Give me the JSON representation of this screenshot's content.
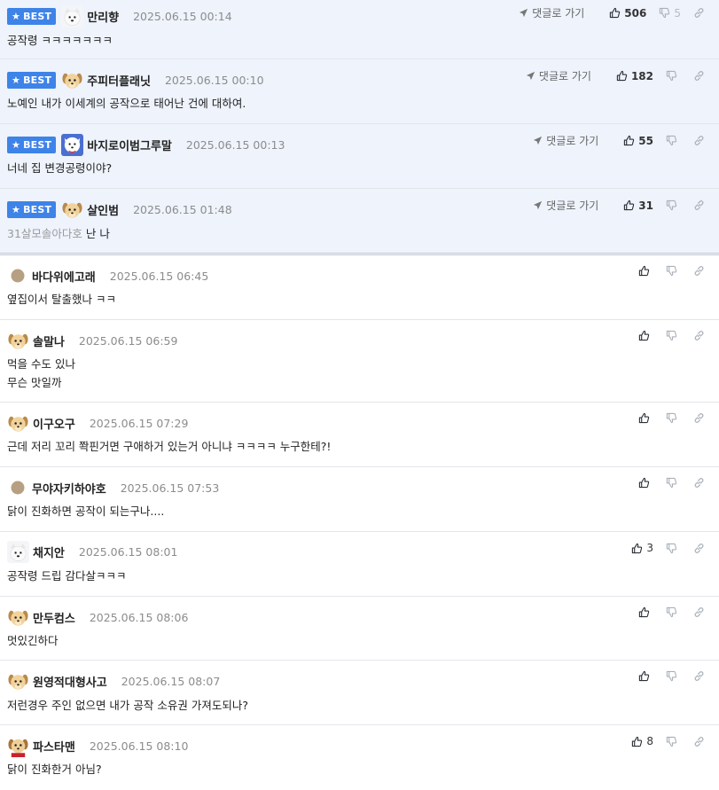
{
  "best_badge": "BEST",
  "goto_label": "댓글로 가기",
  "comments": [
    {
      "best": true,
      "avatar": "white-dog",
      "nick": "만리향",
      "date": "2025.06.15 00:14",
      "mention": "",
      "lines": [
        "공작령 ㅋㅋㅋㅋㅋㅋㅋ"
      ],
      "up": "506",
      "down": "5"
    },
    {
      "best": true,
      "avatar": "puppy",
      "nick": "주피터플래닛",
      "date": "2025.06.15 00:10",
      "mention": "",
      "lines": [
        "노예인 내가 이세계의 공작으로 태어난 건에 대하여."
      ],
      "up": "182",
      "down": ""
    },
    {
      "best": true,
      "avatar": "blue-pup",
      "nick": "바지로이범그루말",
      "date": "2025.06.15 00:13",
      "mention": "",
      "lines": [
        "너네 집 변경공령이야?"
      ],
      "up": "55",
      "down": ""
    },
    {
      "best": true,
      "avatar": "puppy",
      "nick": "살인범",
      "date": "2025.06.15 01:48",
      "mention": "31살모솔아다호",
      "lines": [
        "난 나"
      ],
      "up": "31",
      "down": ""
    },
    {
      "best": false,
      "avatar": "circle",
      "nick": "바다위에고래",
      "date": "2025.06.15 06:45",
      "mention": "",
      "lines": [
        "옆집이서 탈출했나 ㅋㅋ"
      ],
      "up": "",
      "down": ""
    },
    {
      "best": false,
      "avatar": "puppy",
      "nick": "솔말나",
      "date": "2025.06.15 06:59",
      "mention": "",
      "lines": [
        "먹을 수도 있나",
        "무슨 맛일까"
      ],
      "up": "",
      "down": ""
    },
    {
      "best": false,
      "avatar": "puppy",
      "nick": "이구오구",
      "date": "2025.06.15 07:29",
      "mention": "",
      "lines": [
        "근데 저리 꼬리 쫙핀거면 구애하거 있는거 아니냐 ㅋㅋㅋㅋ 누구한테?!"
      ],
      "up": "",
      "down": ""
    },
    {
      "best": false,
      "avatar": "circle",
      "nick": "무야자키하야호",
      "date": "2025.06.15 07:53",
      "mention": "",
      "lines": [
        "닭이 진화하면 공작이 되는구나...."
      ],
      "up": "",
      "down": ""
    },
    {
      "best": false,
      "avatar": "white-dog",
      "nick": "채지안",
      "date": "2025.06.15 08:01",
      "mention": "",
      "lines": [
        "공작령 드립 감다살ㅋㅋㅋ"
      ],
      "up": "3",
      "down": ""
    },
    {
      "best": false,
      "avatar": "puppy",
      "nick": "만두컴스",
      "date": "2025.06.15 08:06",
      "mention": "",
      "lines": [
        "멋있긴하다"
      ],
      "up": "",
      "down": ""
    },
    {
      "best": false,
      "avatar": "puppy",
      "nick": "원영적대형사고",
      "date": "2025.06.15 08:07",
      "mention": "",
      "lines": [
        "저런경우 주인 없으면 내가 공작 소유권 가져도되나?"
      ],
      "up": "",
      "down": ""
    },
    {
      "best": false,
      "avatar": "red-pup",
      "nick": "파스타맨",
      "date": "2025.06.15 08:10",
      "mention": "",
      "lines": [
        "닭이 진화한거 아님?"
      ],
      "up": "8",
      "down": ""
    }
  ]
}
